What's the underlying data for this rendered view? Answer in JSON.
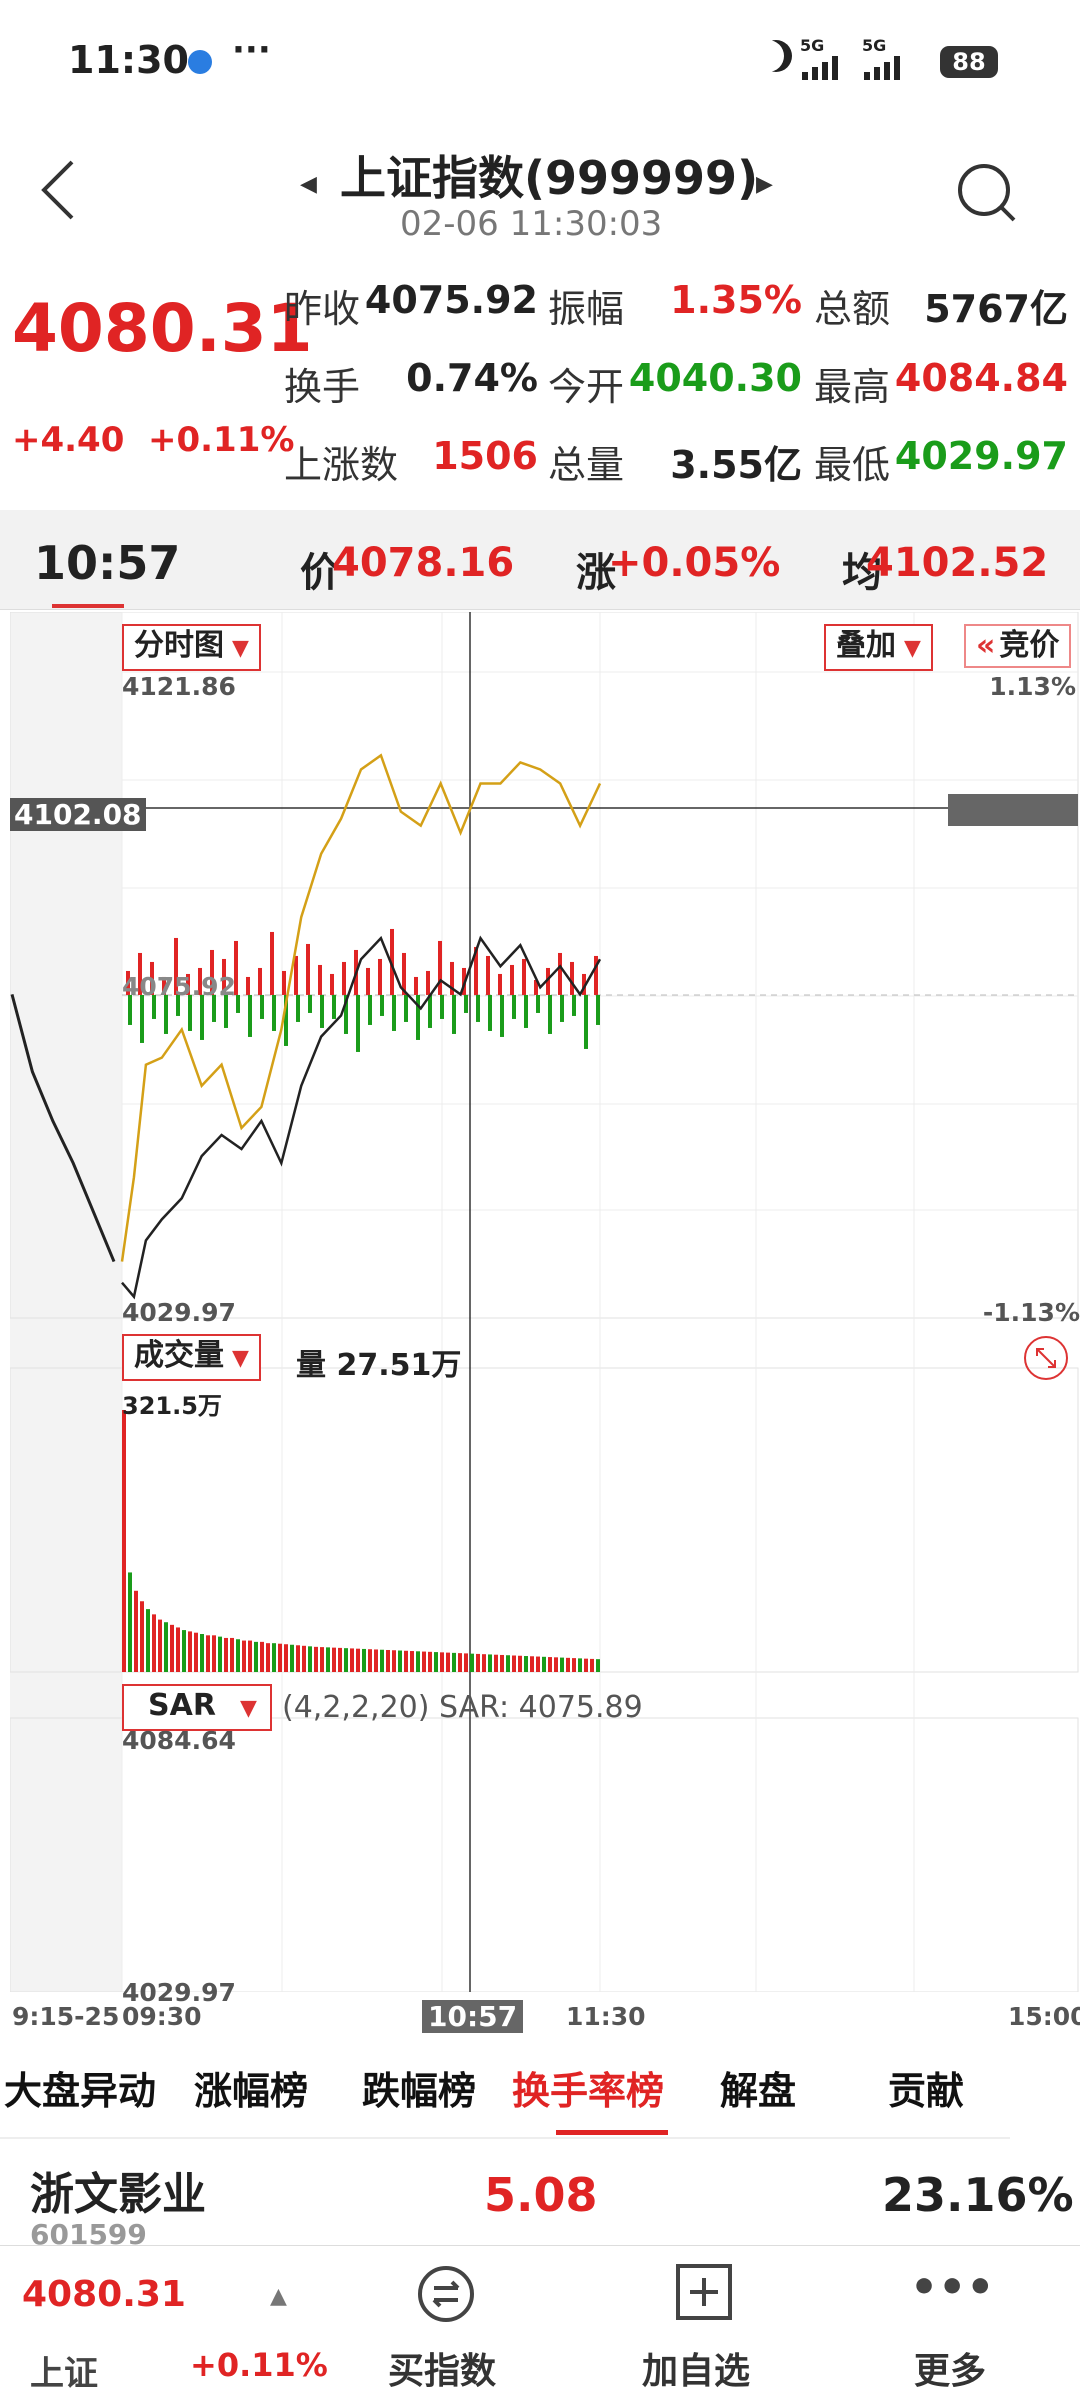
{
  "status_bar": {
    "time": "11:30",
    "dots": "···",
    "network_1": "5G",
    "network_2": "5G",
    "battery": "88"
  },
  "header": {
    "title": "上证指数(999999)",
    "datetime": "02-06 11:30:03"
  },
  "quote": {
    "price": "4080.31",
    "change": "+4.40",
    "change_pct": "+0.11%",
    "rows": [
      [
        {
          "label": "昨收",
          "value": "4075.92",
          "color": "#222222"
        },
        {
          "label": "振幅",
          "value": "1.35%",
          "color": "#e02424"
        },
        {
          "label": "总额",
          "value": "5767亿",
          "color": "#222222"
        }
      ],
      [
        {
          "label": "换手",
          "value": "0.74%",
          "color": "#222222"
        },
        {
          "label": "今开",
          "value": "4040.30",
          "color": "#1a9c1a"
        },
        {
          "label": "最高",
          "value": "4084.84",
          "color": "#e02424"
        }
      ],
      [
        {
          "label": "上涨数",
          "value": "1506",
          "color": "#e02424"
        },
        {
          "label": "总量",
          "value": "3.55亿",
          "color": "#222222"
        },
        {
          "label": "最低",
          "value": "4029.97",
          "color": "#1a9c1a"
        }
      ]
    ]
  },
  "crosshair": {
    "time": "10:57",
    "price_label": "价",
    "price": "4078.16",
    "change_label": "涨",
    "change": "+0.05%",
    "avg_label": "均",
    "avg": "4102.52"
  },
  "chart_data": {
    "type": "line",
    "title": "分时图",
    "ylim": [
      4029.97,
      4121.86
    ],
    "y_tick_labels": [
      "4121.86",
      "4075.92",
      "4029.97"
    ],
    "pct_labels": [
      "1.13%",
      "-1.13%"
    ],
    "x_tick_labels": [
      "9:15-25",
      "09:30",
      "10:57",
      "11:30",
      "15:00"
    ],
    "crosshair_value": "4102.08",
    "prev_close": 4075.92,
    "series": [
      {
        "color": "#222222",
        "x": [
          "09:30",
          "09:33",
          "09:36",
          "09:40",
          "09:45",
          "09:50",
          "09:55",
          "10:00",
          "10:05",
          "10:10",
          "10:15",
          "10:20",
          "10:25",
          "10:30",
          "10:35",
          "10:40",
          "10:45",
          "10:50",
          "10:55",
          "11:00",
          "11:05",
          "11:10",
          "11:15",
          "11:20",
          "11:25",
          "11:30"
        ],
        "values": [
          4035,
          4033,
          4041,
          4044,
          4047,
          4053,
          4056,
          4054,
          4058,
          4052,
          4063,
          4070,
          4073,
          4081,
          4084,
          4077,
          4074,
          4078,
          4076,
          4084,
          4080,
          4083,
          4077,
          4080,
          4076,
          4081
        ]
      },
      {
        "color": "#d4a017",
        "x": [
          "09:30",
          "09:33",
          "09:36",
          "09:40",
          "09:45",
          "09:50",
          "09:55",
          "10:00",
          "10:05",
          "10:10",
          "10:15",
          "10:20",
          "10:25",
          "10:30",
          "10:35",
          "10:40",
          "10:45",
          "10:50",
          "10:55",
          "11:00",
          "11:05",
          "11:10",
          "11:15",
          "11:20",
          "11:25",
          "11:30"
        ],
        "values": [
          4038,
          4050,
          4066,
          4067,
          4071,
          4063,
          4066,
          4057,
          4060,
          4071,
          4087,
          4096,
          4101,
          4108,
          4110,
          4102,
          4100,
          4106,
          4099,
          4106,
          4106,
          4109,
          4108,
          4106,
          4100,
          4106
        ]
      }
    ],
    "pre_market": {
      "color": "#222222",
      "x": [
        "09:15",
        "09:17",
        "09:19",
        "09:21",
        "09:23",
        "09:25"
      ],
      "values": [
        4076,
        4065,
        4058,
        4052,
        4045,
        4038
      ]
    },
    "bar_top": [
      8,
      14,
      11,
      6,
      19,
      7,
      9,
      15,
      12,
      18,
      6,
      9,
      21,
      8,
      13,
      17,
      10,
      7,
      11,
      15,
      9,
      12,
      22,
      14,
      6,
      8,
      18,
      11,
      9,
      16,
      13,
      7,
      10,
      12,
      5,
      9,
      14,
      11,
      7,
      13
    ],
    "bar_bottom": [
      10,
      16,
      8,
      13,
      7,
      12,
      15,
      9,
      11,
      6,
      14,
      8,
      12,
      17,
      9,
      6,
      11,
      8,
      13,
      19,
      10,
      7,
      12,
      9,
      15,
      11,
      8,
      13,
      6,
      9,
      12,
      14,
      8,
      11,
      6,
      13,
      9,
      7,
      18,
      10
    ]
  },
  "volume": {
    "label": "成交量",
    "amount": "量 27.51万",
    "max_label": "321.5万",
    "bars": [
      100,
      38,
      31,
      27,
      24,
      22,
      20,
      19,
      18,
      17,
      16,
      15.5,
      15,
      14.5,
      14,
      14,
      13.5,
      13,
      13,
      12.5,
      12,
      12,
      11.5,
      11.5,
      11,
      11,
      10.8,
      10.6,
      10.4,
      10.2,
      10,
      9.8,
      9.6,
      9.5,
      9.4,
      9.3,
      9.2,
      9.1,
      9,
      8.9,
      8.8,
      8.7,
      8.6,
      8.5,
      8.4,
      8.3,
      8.2,
      8.1,
      8,
      7.9,
      7.8,
      7.7,
      7.6,
      7.5,
      7.4,
      7.3,
      7.2,
      7.1,
      7,
      6.9,
      6.8,
      6.7,
      6.6,
      6.5,
      6.4,
      6.3,
      6.2,
      6.1,
      6,
      5.9,
      5.8,
      5.7,
      5.6,
      5.5,
      5.4,
      5.3,
      5.2,
      5.1,
      5,
      4.9
    ]
  },
  "sar": {
    "label": "SAR",
    "params": "(4,2,2,20) SAR: 4075.89",
    "high": "4084.64",
    "low": "4029.97"
  },
  "overlay_button": "叠加",
  "auction_button": "竞价",
  "tabs": [
    "大盘异动",
    "涨幅榜",
    "跌幅榜",
    "换手率榜",
    "解盘",
    "贡献"
  ],
  "active_tab": 3,
  "stock": {
    "name": "浙文影业",
    "code": "601599",
    "price": "5.08",
    "pct": "23.16%"
  },
  "bottom": {
    "price": "4080.31",
    "name": "上证",
    "pct": "+0.11%",
    "buy": "买指数",
    "add": "加自选",
    "more": "更多"
  }
}
